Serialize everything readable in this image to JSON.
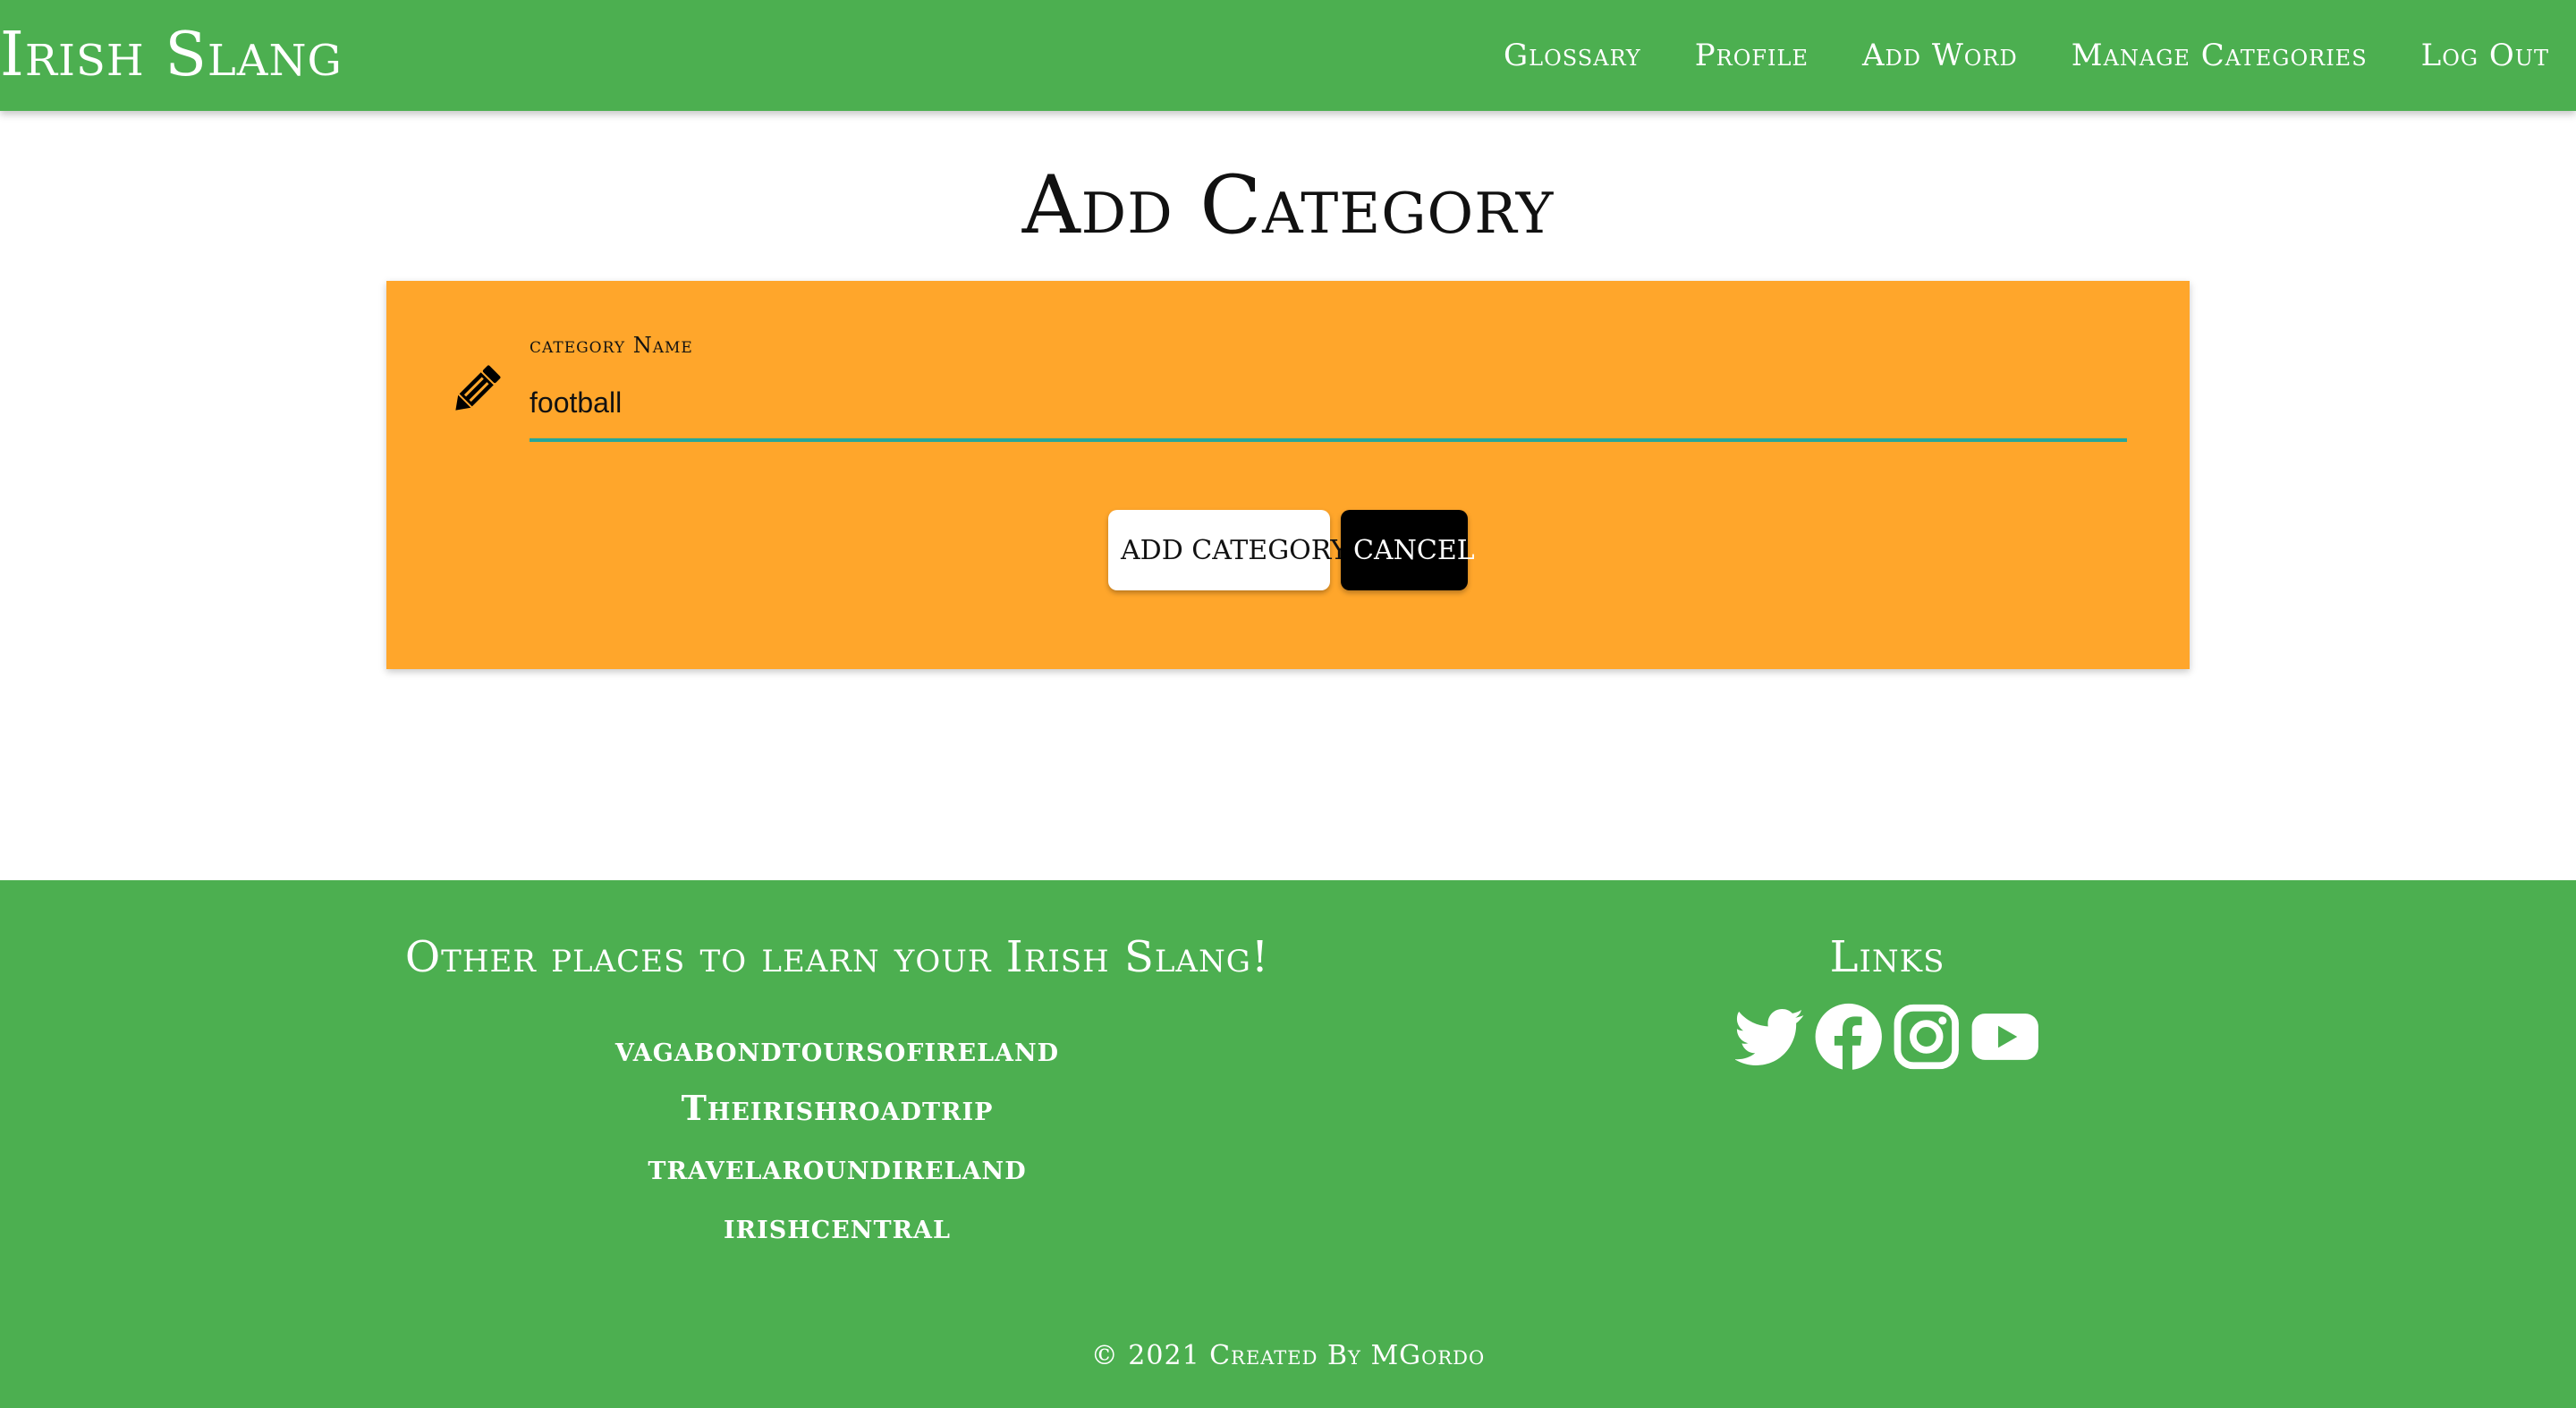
{
  "nav": {
    "brand": "Irish Slang",
    "links": [
      "Glossary",
      "Profile",
      "Add Word",
      "Manage Categories",
      "Log Out"
    ]
  },
  "page": {
    "title": "Add Category"
  },
  "form": {
    "label": "category Name",
    "value": "football",
    "icon": "pencil-icon",
    "add_button": "ADD CATEGORY",
    "cancel_button": "CANCEL"
  },
  "footer": {
    "resources_heading": "Other places to learn your Irish Slang!",
    "resources": [
      "vagabondtoursofireland",
      "Theirishroadtrip",
      "travelaroundireland",
      "irishcentral"
    ],
    "links_heading": "Links",
    "social_icons": [
      "twitter-icon",
      "facebook-icon",
      "instagram-icon",
      "youtube-icon"
    ],
    "copyright": "© 2021 Created By MGordo"
  },
  "colors": {
    "brand_green": "#4caf50",
    "card_orange": "#ffa62b",
    "input_underline": "#26a69a"
  }
}
